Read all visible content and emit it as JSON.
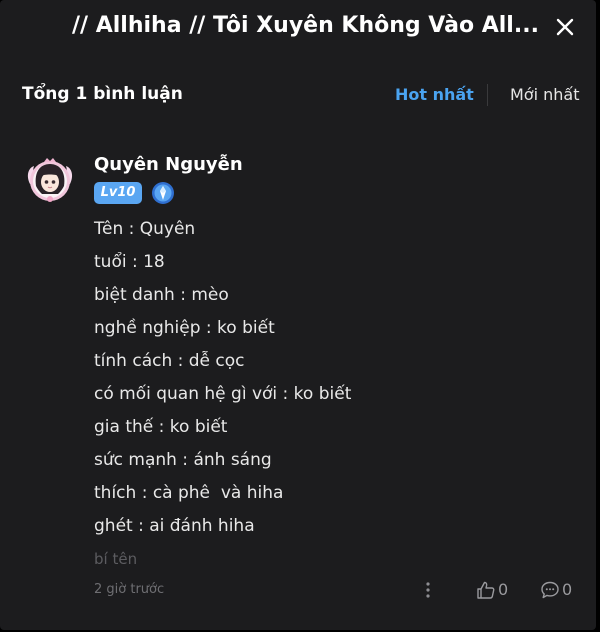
{
  "header": {
    "title": "// Allhiha // Tôi Xuyên Không Vào All...",
    "close_icon": "close-icon"
  },
  "comments_bar": {
    "count_label": "Tổng 1 bình luận",
    "sort_hot": "Hot nhất",
    "sort_new": "Mới nhất",
    "active_sort_color": "#4aa3f0"
  },
  "comment": {
    "username": "Quyên Nguyễn",
    "level": "Lv10",
    "level_color": "#5aa6f2",
    "rank_icon": "rank-badge-icon",
    "lines": [
      "Tên : Quyên",
      "tuổi : 18",
      "biệt danh : mèo",
      "nghề nghiệp : ko biết",
      "tính cách : dễ cọc",
      "có mối quan hệ gì với : ko biết",
      "gia thế : ko biết",
      "sức mạnh : ánh sáng",
      "thích : cà phê  và hiha",
      "ghét : ai đánh hiha"
    ],
    "muted_line": "bí tên",
    "timestamp": "2 giờ trước",
    "likes": "0",
    "replies": "0"
  }
}
